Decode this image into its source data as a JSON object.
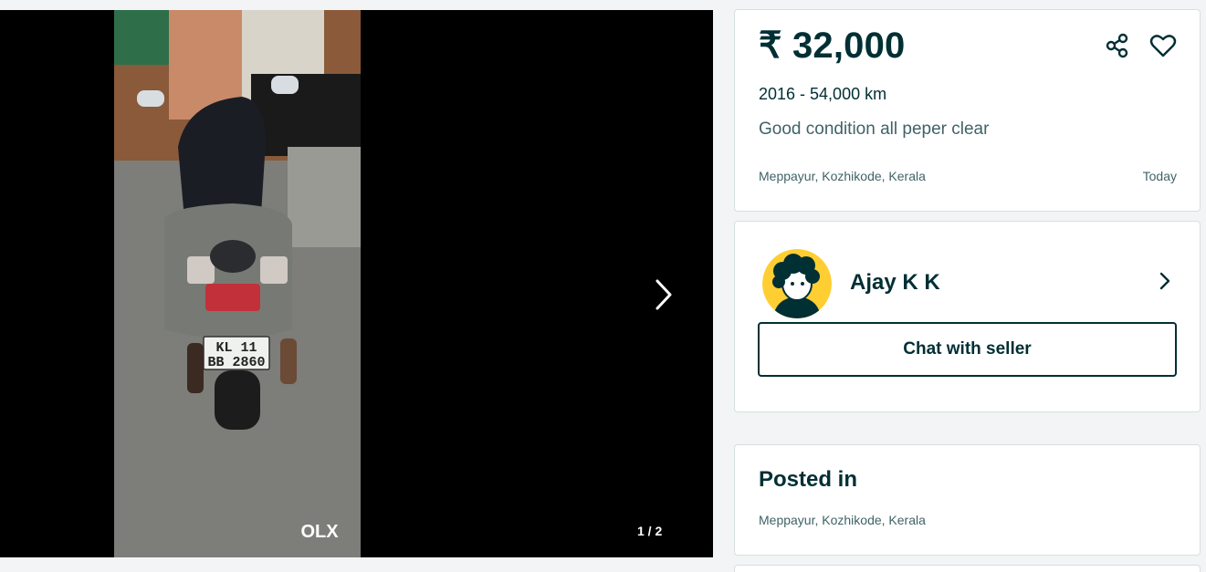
{
  "gallery": {
    "counter": "1 / 2",
    "plate_line1": "KL 11",
    "plate_line2": "BB 2860",
    "watermark": "OLX"
  },
  "listing": {
    "price": "₹ 32,000",
    "meta": "2016 - 54,000 km",
    "description": "Good condition all peper clear",
    "location": "Meppayur, Kozhikode, Kerala",
    "date": "Today"
  },
  "seller": {
    "name": "Ajay K K",
    "chat_label": "Chat with seller"
  },
  "posted": {
    "title": "Posted in",
    "location": "Meppayur, Kozhikode, Kerala"
  },
  "icons": {
    "share": "share-icon",
    "favorite": "heart-icon",
    "next": "chevron-right-icon",
    "seller_link": "chevron-right-icon"
  },
  "colors": {
    "primary": "#002f34",
    "secondary_text": "#406367",
    "avatar_bg": "#ffce32",
    "page_bg": "#f2f4f5"
  }
}
